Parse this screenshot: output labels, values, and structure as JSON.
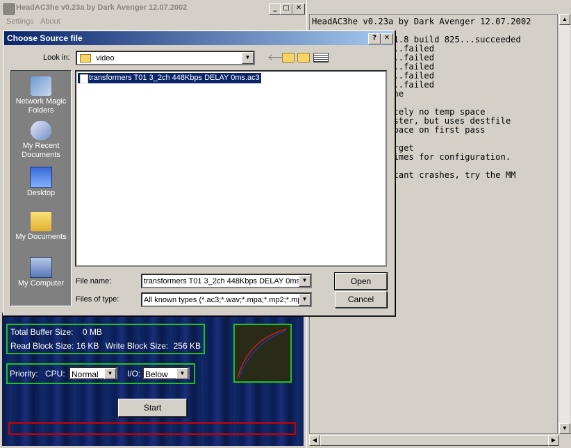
{
  "app": {
    "title": "HeadAC3he v0.23a by Dark Avenger 12.07.2002",
    "menu": [
      "Settings",
      "About"
    ],
    "buffer_size_label": "Total Buffer Size:",
    "buffer_size_value": "0 MB",
    "read_block_label": "Read Block Size:",
    "read_block_value": "16 KB",
    "write_block_label": "Write Block Size:",
    "write_block_value": "256 KB",
    "priority_label": "Priority:",
    "cpu_label": "CPU:",
    "cpu_value": "Normal",
    "io_label": "I/O:",
    "io_value": "Below",
    "start_label": "Start"
  },
  "console": {
    "lines": [
      "HeadAC3he v0.23a by Dark Avenger 12.07.2002",
      "",
      "          d.dll 1.8 build 825...succeeded",
      "          c.dll...failed",
      "          c.dll...failed",
      "          s.dll...failed",
      "          c.dll...failed",
      "          b.dll...failed",
      "          e...done",
      "",
      "          absolutely no temp space",
      "          ch) faster, but uses destfile",
      "          temp space on first pass",
      "",
      "          ate target",
      "          ns 2 times for configuration.",
      "",
      "          ce instant crashes, try the MM"
    ]
  },
  "dialog": {
    "title": "Choose Source file",
    "help_glyph": "?",
    "close_glyph": "✕",
    "look_in_label": "Look in:",
    "look_in_value": "video",
    "places": [
      "Network Magic Folders",
      "My Recent Documents",
      "Desktop",
      "My Documents",
      "My Computer"
    ],
    "files": [
      "transformers T01 3_2ch 448Kbps DELAY 0ms.ac3"
    ],
    "file_name_label": "File name:",
    "file_name_value": "transformers T01 3_2ch 448Kbps DELAY 0ms.ac3",
    "files_of_type_label": "Files of type:",
    "files_of_type_value": "All known types (*.ac3;*.wav;*.mpa;*.mp2;*.mp3)",
    "open_label": "Open",
    "cancel_label": "Cancel"
  },
  "colors": {
    "dialog_title_start": "#0a246a",
    "dialog_title_end": "#a6caf0",
    "selection": "#0a246a",
    "group_border": "#1fc31f",
    "progress_border": "#cc0000"
  }
}
